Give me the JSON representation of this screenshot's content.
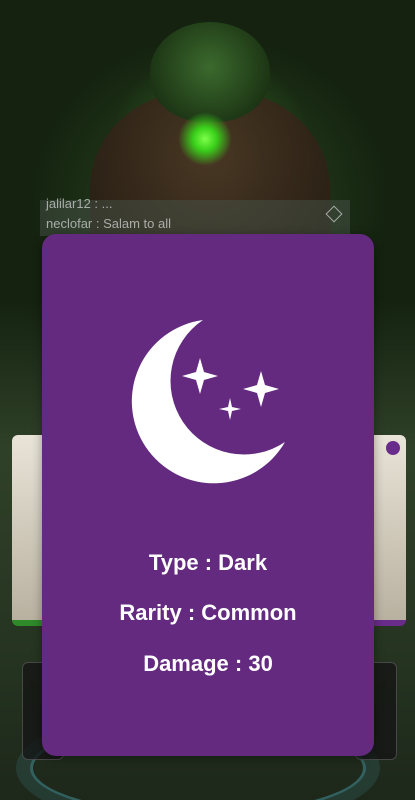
{
  "chat": {
    "line1": "jalilar12 : ...",
    "line2": "neclofar :   Salam to all"
  },
  "card": {
    "icon": "moon-stars-icon",
    "background_color": "#632a7f",
    "type_text": "Type : Dark",
    "rarity_text": "Rarity : Common",
    "damage_text": "Damage : 30"
  }
}
